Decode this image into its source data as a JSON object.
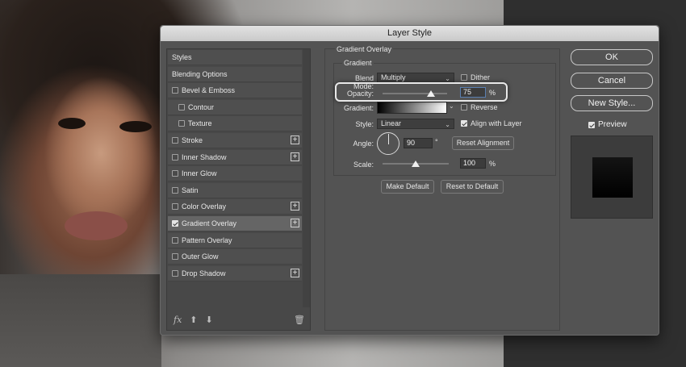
{
  "dialog": {
    "title": "Layer Style"
  },
  "styles_list": {
    "items": [
      {
        "label": "Styles",
        "checkbox": false,
        "checked": false,
        "plus": false,
        "indent": false,
        "selected": false
      },
      {
        "label": "Blending Options",
        "checkbox": false,
        "checked": false,
        "plus": false,
        "indent": false,
        "selected": false
      },
      {
        "label": "Bevel & Emboss",
        "checkbox": true,
        "checked": false,
        "plus": false,
        "indent": false,
        "selected": false
      },
      {
        "label": "Contour",
        "checkbox": true,
        "checked": false,
        "plus": false,
        "indent": true,
        "selected": false
      },
      {
        "label": "Texture",
        "checkbox": true,
        "checked": false,
        "plus": false,
        "indent": true,
        "selected": false
      },
      {
        "label": "Stroke",
        "checkbox": true,
        "checked": false,
        "plus": true,
        "indent": false,
        "selected": false
      },
      {
        "label": "Inner Shadow",
        "checkbox": true,
        "checked": false,
        "plus": true,
        "indent": false,
        "selected": false
      },
      {
        "label": "Inner Glow",
        "checkbox": true,
        "checked": false,
        "plus": false,
        "indent": false,
        "selected": false
      },
      {
        "label": "Satin",
        "checkbox": true,
        "checked": false,
        "plus": false,
        "indent": false,
        "selected": false
      },
      {
        "label": "Color Overlay",
        "checkbox": true,
        "checked": false,
        "plus": true,
        "indent": false,
        "selected": false
      },
      {
        "label": "Gradient Overlay",
        "checkbox": true,
        "checked": true,
        "plus": true,
        "indent": false,
        "selected": true
      },
      {
        "label": "Pattern Overlay",
        "checkbox": true,
        "checked": false,
        "plus": false,
        "indent": false,
        "selected": false
      },
      {
        "label": "Outer Glow",
        "checkbox": true,
        "checked": false,
        "plus": false,
        "indent": false,
        "selected": false
      },
      {
        "label": "Drop Shadow",
        "checkbox": true,
        "checked": false,
        "plus": true,
        "indent": false,
        "selected": false
      }
    ],
    "footer": {
      "fx_label": "fx",
      "up_icon": "arrow-up-icon",
      "down_icon": "arrow-down-icon",
      "trash_icon": "trash-icon"
    }
  },
  "gradient_overlay": {
    "section_title": "Gradient Overlay",
    "group_title": "Gradient",
    "blend_mode_label": "Blend Mode:",
    "blend_mode_value": "Multiply",
    "dither_label": "Dither",
    "dither_checked": false,
    "opacity_label": "Opacity:",
    "opacity_value": "75",
    "opacity_level": 0.75,
    "opacity_unit": "%",
    "gradient_label": "Gradient:",
    "reverse_label": "Reverse",
    "reverse_checked": false,
    "style_label": "Style:",
    "style_value": "Linear",
    "align_label": "Align with Layer",
    "align_checked": true,
    "angle_label": "Angle:",
    "angle_value": "90",
    "angle_unit": "°",
    "reset_alignment_label": "Reset Alignment",
    "scale_label": "Scale:",
    "scale_value": "100",
    "scale_level": 0.5,
    "scale_unit": "%",
    "make_default_label": "Make Default",
    "reset_default_label": "Reset to Default"
  },
  "actions": {
    "ok_label": "OK",
    "cancel_label": "Cancel",
    "new_style_label": "New Style...",
    "preview_label": "Preview",
    "preview_checked": true
  }
}
